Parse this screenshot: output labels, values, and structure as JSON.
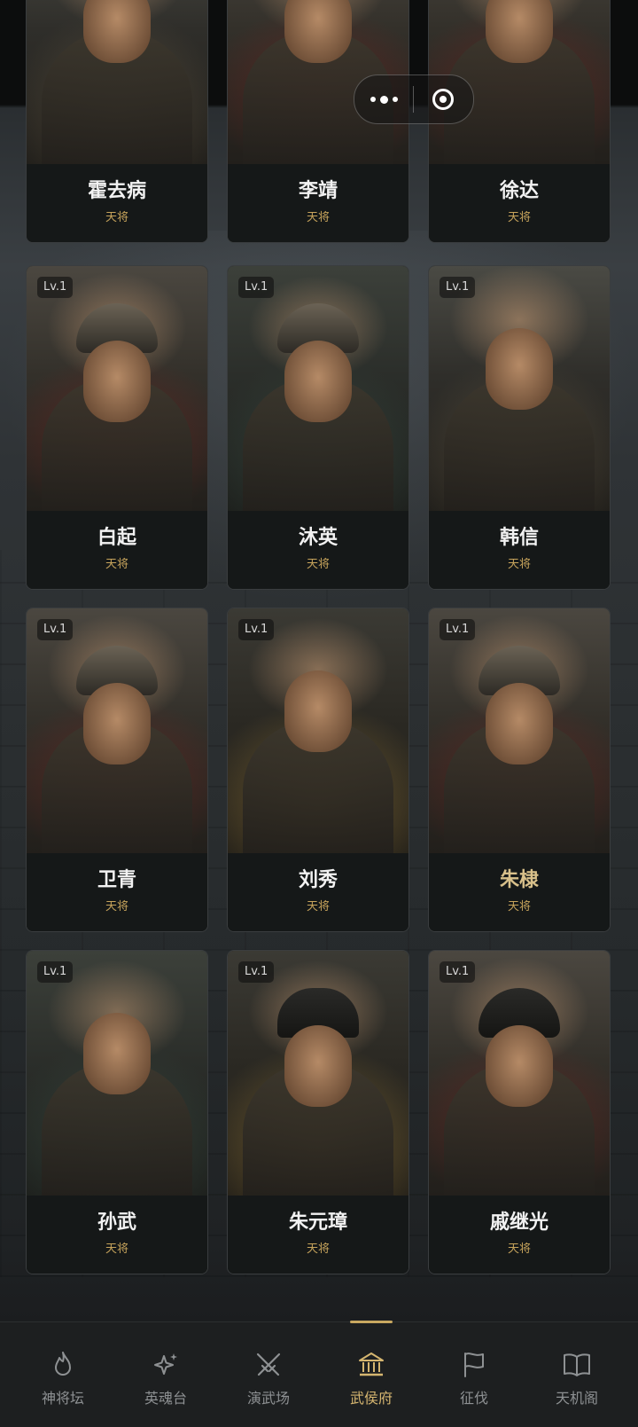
{
  "capsule": {
    "menu_icon": "more-dots-icon",
    "close_icon": "target-circle-icon"
  },
  "generals": [
    {
      "name": "霍去病",
      "rank": "天将",
      "level": ""
    },
    {
      "name": "李靖",
      "rank": "天将",
      "level": ""
    },
    {
      "name": "徐达",
      "rank": "天将",
      "level": ""
    },
    {
      "name": "白起",
      "rank": "天将",
      "level": "Lv.1"
    },
    {
      "name": "沐英",
      "rank": "天将",
      "level": "Lv.1"
    },
    {
      "name": "韩信",
      "rank": "天将",
      "level": "Lv.1"
    },
    {
      "name": "卫青",
      "rank": "天将",
      "level": "Lv.1"
    },
    {
      "name": "刘秀",
      "rank": "天将",
      "level": "Lv.1"
    },
    {
      "name": "朱棣",
      "rank": "天将",
      "level": "Lv.1"
    },
    {
      "name": "孙武",
      "rank": "天将",
      "level": "Lv.1"
    },
    {
      "name": "朱元璋",
      "rank": "天将",
      "level": "Lv.1"
    },
    {
      "name": "戚继光",
      "rank": "天将",
      "level": "Lv.1"
    }
  ],
  "tabbar": {
    "tabs": [
      {
        "label": "神将坛",
        "icon": "flame-icon"
      },
      {
        "label": "英魂台",
        "icon": "sparkle-icon"
      },
      {
        "label": "演武场",
        "icon": "crossed-swords-icon"
      },
      {
        "label": "武侯府",
        "icon": "temple-icon"
      },
      {
        "label": "征伐",
        "icon": "flag-icon"
      },
      {
        "label": "天机阁",
        "icon": "book-icon"
      }
    ],
    "active_index": 3
  },
  "colors": {
    "accent": "#d6b670",
    "rank": "#c6a35b",
    "name_highlight": "#d8c08a",
    "background": "#1b1d1e"
  }
}
